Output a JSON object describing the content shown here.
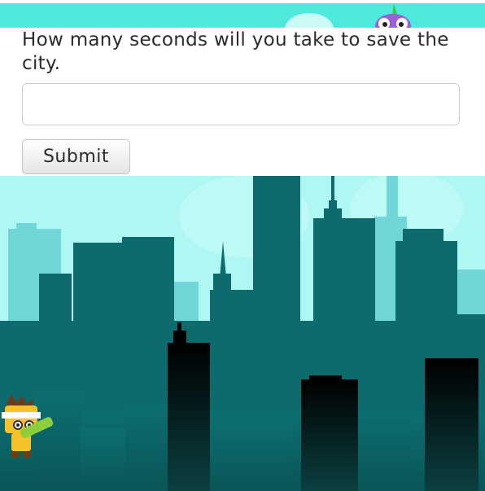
{
  "quiz": {
    "question": "How many seconds will you take to save the city.",
    "answer_value": "",
    "answer_placeholder": "",
    "submit_label": "Submit"
  },
  "scene": {
    "sky_color": "#aef7f2",
    "skyline_colors": [
      "#71d6d8",
      "#0e6b6d",
      "#0b0b0b"
    ],
    "characters": [
      "hero-ninja",
      "purple-monster"
    ]
  }
}
